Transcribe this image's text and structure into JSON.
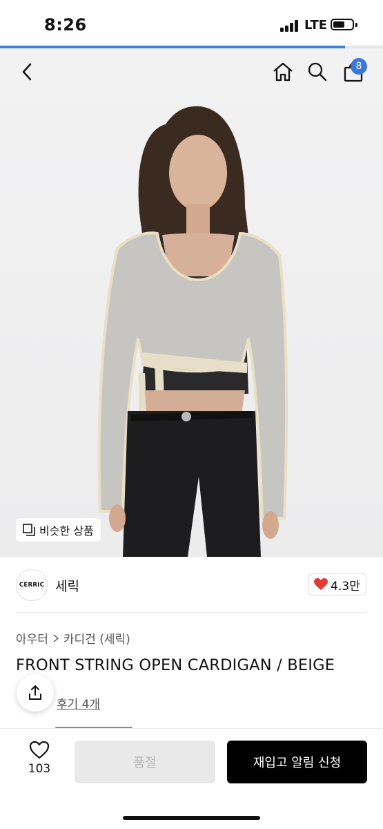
{
  "status_bar": {
    "time": "8:26",
    "network": "LTE",
    "battery_level": 0.6
  },
  "page_load_progress": 0.9,
  "nav": {
    "cart_count": "8",
    "icons": [
      "back-icon",
      "home-icon",
      "search-icon",
      "cart-icon"
    ]
  },
  "hero": {
    "similar_products_label": "비슷한 상품"
  },
  "brand": {
    "logo_text": "CERRIC",
    "name": "세릭",
    "likes": "4.3만"
  },
  "breadcrumb": {
    "items": [
      "아우터",
      "카디건 (세릭)"
    ]
  },
  "product": {
    "title": "FRONT STRING OPEN CARDIGAN / BEIGE",
    "review_link": "후기 4개"
  },
  "bottom_bar": {
    "wish_count": "103",
    "soldout_label": "품절",
    "restock_label": "재입고 알림 신청"
  },
  "colors": {
    "accent_blue": "#3b78d8",
    "heart_red": "#e53935",
    "primary_black": "#000000",
    "disabled_gray": "#e9e9ea"
  }
}
